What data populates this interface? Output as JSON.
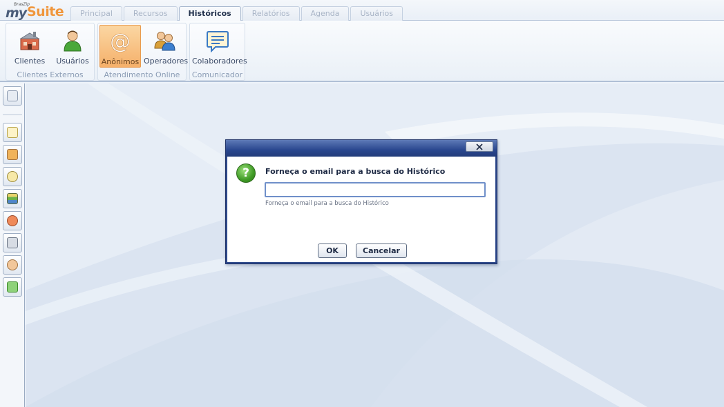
{
  "app": {
    "logo_brand": "BrasZip",
    "logo_my": "my",
    "logo_suite": "Suite"
  },
  "tabs": [
    {
      "label": "Principal",
      "active": false
    },
    {
      "label": "Recursos",
      "active": false
    },
    {
      "label": "Históricos",
      "active": true
    },
    {
      "label": "Relatórios",
      "active": false
    },
    {
      "label": "Agenda",
      "active": false
    },
    {
      "label": "Usuários",
      "active": false
    }
  ],
  "ribbon": {
    "groups": [
      {
        "label": "Clientes Externos",
        "buttons": [
          {
            "label": "Clientes",
            "icon": "building-icon"
          },
          {
            "label": "Usuários",
            "icon": "user-icon"
          }
        ]
      },
      {
        "label": "Atendimento Online",
        "buttons": [
          {
            "label": "Anônimos",
            "icon": "at-sign-icon",
            "active": true
          },
          {
            "label": "Operadores",
            "icon": "operators-icon"
          }
        ]
      },
      {
        "label": "Comunicador",
        "buttons": [
          {
            "label": "Colaboradores",
            "icon": "chat-bubble-icon"
          }
        ]
      }
    ]
  },
  "leftbar": {
    "icons": [
      "contacts-icon",
      "notepad-icon",
      "users-group-icon",
      "clock-notes-icon",
      "books-icon",
      "chat-user-icon",
      "newspaper-icon",
      "support-agent-icon",
      "transfer-icon"
    ]
  },
  "dialog": {
    "message": "Forneça o email para a busca do Histórico",
    "input_value": "",
    "hint": "Forneça o email para a busca do Histórico",
    "ok_label": "OK",
    "cancel_label": "Cancelar",
    "icon": "question-icon",
    "question_glyph": "?"
  },
  "colors": {
    "accent_orange": "#f0963c",
    "title_blue": "#2a478f",
    "workspace_bg": "#dde6f2"
  }
}
